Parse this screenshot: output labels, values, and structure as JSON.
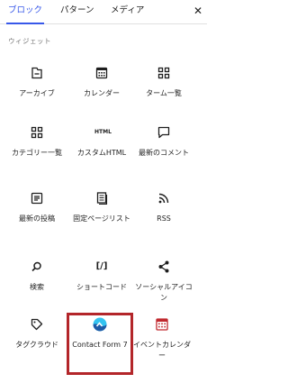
{
  "tabs": [
    "ブロック",
    "パターン",
    "メディア"
  ],
  "close": "✕",
  "section": "ウィジェット",
  "blocks": [
    {
      "label": "アーカイブ",
      "icon": "archive-icon"
    },
    {
      "label": "カレンダー",
      "icon": "calendar-icon"
    },
    {
      "label": "ターム一覧",
      "icon": "term-list-icon"
    },
    {
      "label": "カテゴリー一覧",
      "icon": "categories-icon"
    },
    {
      "label": "カスタムHTML",
      "icon": "html-icon",
      "icon_text": "HTML"
    },
    {
      "label": "最新のコメント",
      "icon": "comment-icon"
    },
    {
      "label": "最新の投稿",
      "icon": "latest-posts-icon"
    },
    {
      "label": "固定ページリスト",
      "icon": "page-list-icon"
    },
    {
      "label": "RSS",
      "icon": "rss-icon"
    },
    {
      "label": "検索",
      "icon": "search-icon"
    },
    {
      "label": "ショートコード",
      "icon": "shortcode-icon",
      "icon_text": "[/]"
    },
    {
      "label": "ソーシャルアイコン",
      "icon": "share-icon"
    },
    {
      "label": "タグクラウド",
      "icon": "tag-icon"
    },
    {
      "label": "Contact Form 7",
      "icon": "contact-form-7-icon"
    },
    {
      "label": "イベントカレンダー",
      "icon": "event-calendar-icon"
    }
  ],
  "colors": {
    "accent": "#3858e9",
    "highlight": "#b3262a",
    "cf7_blue": "#33c3f0",
    "event_red": "#c0272d"
  }
}
